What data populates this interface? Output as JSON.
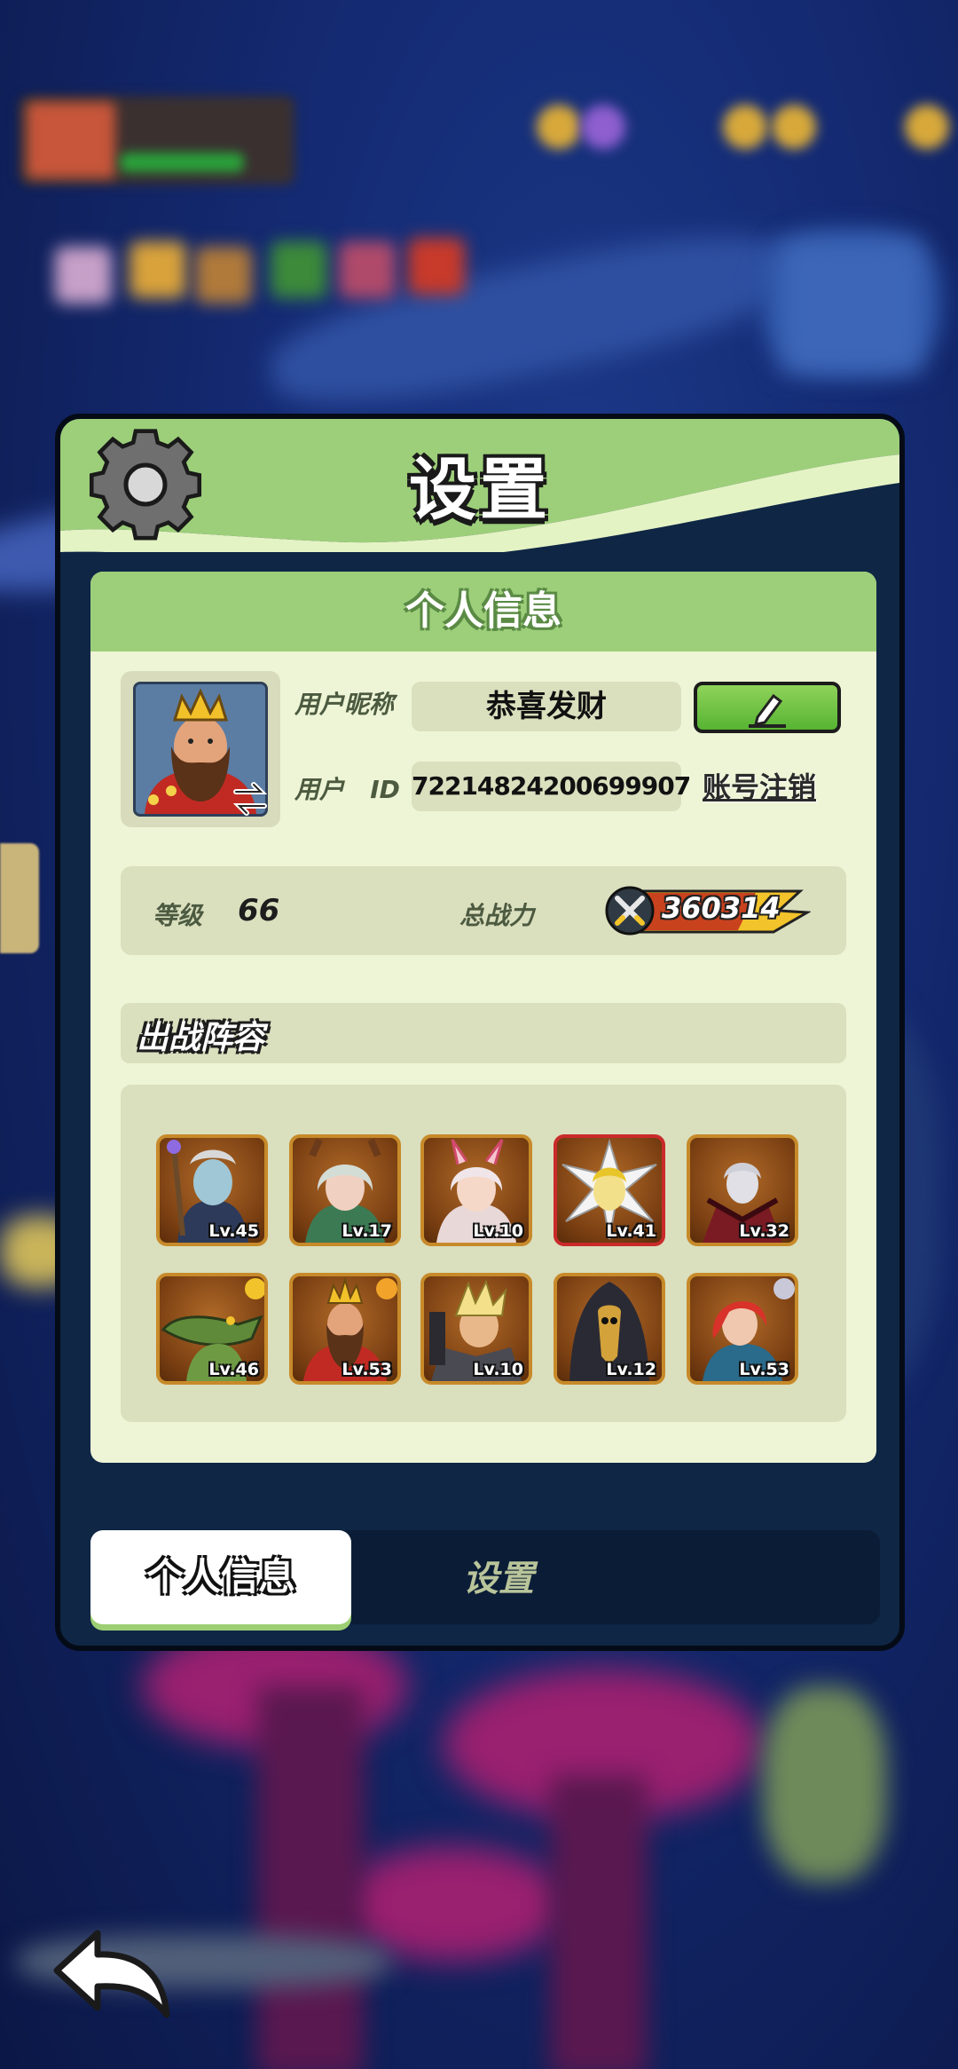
{
  "dialog": {
    "title": "设置"
  },
  "profile": {
    "section_title": "个人信息",
    "nickname_label": "用户昵称",
    "nickname_value": "恭喜发财",
    "id_label": "用户",
    "id_label_suffix": "ID",
    "id_value": "72214824200699907",
    "account_cancel_label": "账号注销",
    "level_label": "等级",
    "level_value": "66",
    "power_label": "总战力",
    "power_value": "360314"
  },
  "lineup": {
    "title": "出战阵容",
    "heroes": [
      {
        "level": "Lv.45"
      },
      {
        "level": "Lv.17"
      },
      {
        "level": "Lv.10"
      },
      {
        "level": "Lv.41"
      },
      {
        "level": "Lv.32"
      },
      {
        "level": "Lv.46"
      },
      {
        "level": "Lv.53"
      },
      {
        "level": "Lv.10"
      },
      {
        "level": "Lv.12"
      },
      {
        "level": "Lv.53"
      }
    ]
  },
  "tabs": [
    {
      "label": "个人信息",
      "active": true
    },
    {
      "label": "设置",
      "active": false
    }
  ],
  "colors": {
    "header_green": "#9dcf7a",
    "panel_bg": "#eef5d6",
    "dialog_bg": "#0f2645",
    "frame_gold": "#c78a2a",
    "frame_red": "#c92a2a"
  },
  "icons": [
    "gear-icon",
    "edit-icon",
    "swap-icon",
    "swords-icon",
    "back-arrow-icon"
  ]
}
